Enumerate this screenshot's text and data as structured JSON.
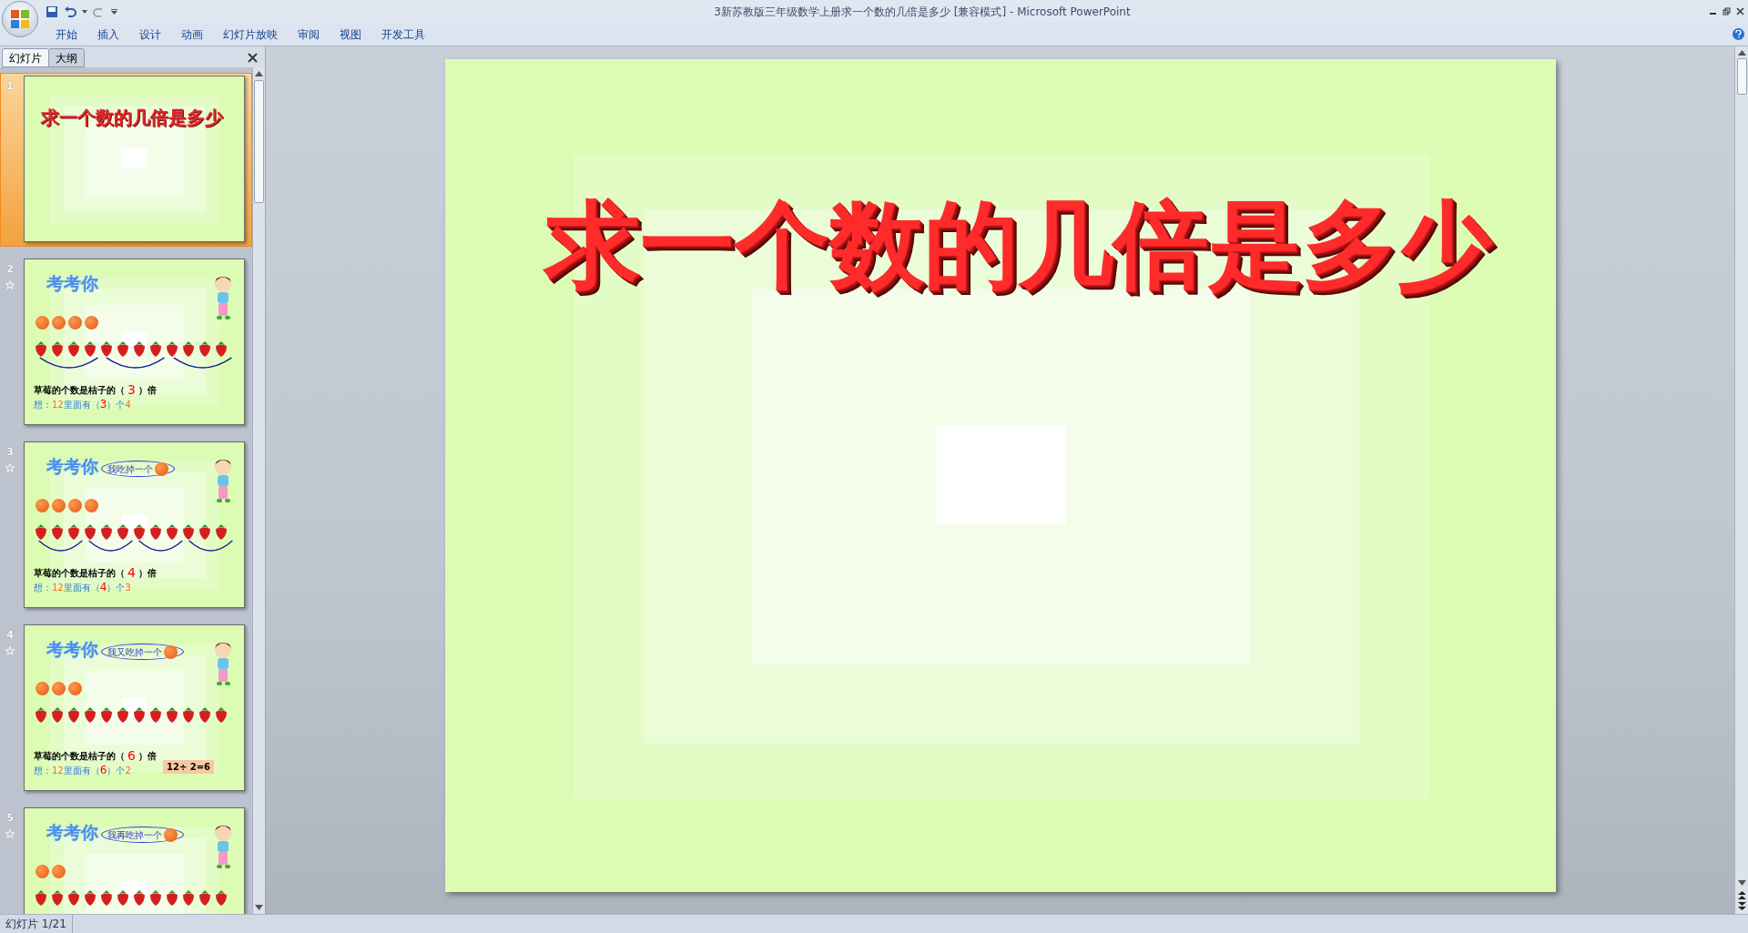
{
  "window": {
    "title": "3新苏教版三年级数学上册求一个数的几倍是多少 [兼容模式] - Microsoft PowerPoint"
  },
  "ribbon_tabs": [
    {
      "label": "开始",
      "selected": false
    },
    {
      "label": "插入",
      "selected": false
    },
    {
      "label": "设计",
      "selected": false
    },
    {
      "label": "动画",
      "selected": false
    },
    {
      "label": "幻灯片放映",
      "selected": false
    },
    {
      "label": "审阅",
      "selected": false
    },
    {
      "label": "视图",
      "selected": false
    },
    {
      "label": "开发工具",
      "selected": false
    }
  ],
  "panel_tabs": [
    {
      "label": "幻灯片",
      "selected": true
    },
    {
      "label": "大纲",
      "selected": false
    }
  ],
  "slides": [
    {
      "number": "1",
      "selected": true,
      "has_animation": false,
      "kind": "title",
      "title": "求一个数的几倍是多少"
    },
    {
      "number": "2",
      "selected": false,
      "has_animation": true,
      "kind": "quiz",
      "heading": "考考你",
      "sentence_before": "草莓的个数是桔子的（",
      "answer": "3",
      "sentence_after": "）倍",
      "hint_lead": "想：",
      "hint_number": "12",
      "hint_mid": "里面有（",
      "hint_answer": "3",
      "hint_after": "）个",
      "hint_tail": "4"
    },
    {
      "number": "3",
      "selected": false,
      "has_animation": true,
      "kind": "quiz",
      "heading": "考考你",
      "bubble": "我吃掉一个",
      "sentence_before": "草莓的个数是桔子的（",
      "answer": "4",
      "sentence_after": "）倍",
      "hint_lead": "想：",
      "hint_number": "12",
      "hint_mid": "里面有（",
      "hint_answer": "4",
      "hint_after": "）个",
      "hint_tail": "3"
    },
    {
      "number": "4",
      "selected": false,
      "has_animation": true,
      "kind": "quiz",
      "heading": "考考你",
      "bubble": "我又吃掉一个",
      "sentence_before": "草莓的个数是桔子的（",
      "answer": "6",
      "sentence_after": "）倍",
      "hint_lead": "想：",
      "hint_number": "12",
      "hint_mid": "里面有（",
      "hint_answer": "6",
      "hint_after": "）个",
      "hint_tail": "2",
      "equation": "12÷ 2=6"
    },
    {
      "number": "5",
      "selected": false,
      "has_animation": true,
      "kind": "quiz",
      "heading": "考考你",
      "bubble": "我再吃掉一个"
    }
  ],
  "main_slide": {
    "title": "求一个数的几倍是多少"
  },
  "status_bar": {
    "slide_info": "幻灯片 1/21"
  }
}
